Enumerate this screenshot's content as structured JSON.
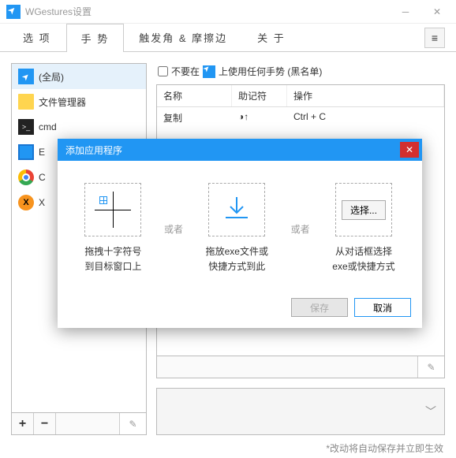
{
  "window": {
    "title": "WGestures设置"
  },
  "tabs": {
    "options": "选 项",
    "gestures": "手 势",
    "trigger": "触发角 & 摩擦边",
    "about": "关 于"
  },
  "sidebar": {
    "items": [
      {
        "label": "(全局)"
      },
      {
        "label": "文件管理器"
      },
      {
        "label": "cmd"
      },
      {
        "label": "E"
      },
      {
        "label": "C"
      },
      {
        "label": "X"
      }
    ],
    "add": "+",
    "remove": "−"
  },
  "blacklist": {
    "pre": "不要在",
    "post": "上使用任何手势 (黑名单)"
  },
  "table": {
    "headers": {
      "name": "名称",
      "mnemonic": "助记符",
      "operation": "操作"
    },
    "rows": [
      {
        "name": "复制",
        "mnemonic": "◑↑",
        "operation": "Ctrl + C"
      }
    ]
  },
  "modal": {
    "title": "添加应用程序",
    "or": "或者",
    "method1": {
      "line1": "拖拽十字符号",
      "line2": "到目标窗口上"
    },
    "method2": {
      "line1": "拖放exe文件或",
      "line2": "快捷方式到此"
    },
    "method3": {
      "button": "选择...",
      "line1": "从对话框选择",
      "line2": "exe或快捷方式"
    },
    "save": "保存",
    "cancel": "取消"
  },
  "footer": "*改动将自动保存并立即生效"
}
